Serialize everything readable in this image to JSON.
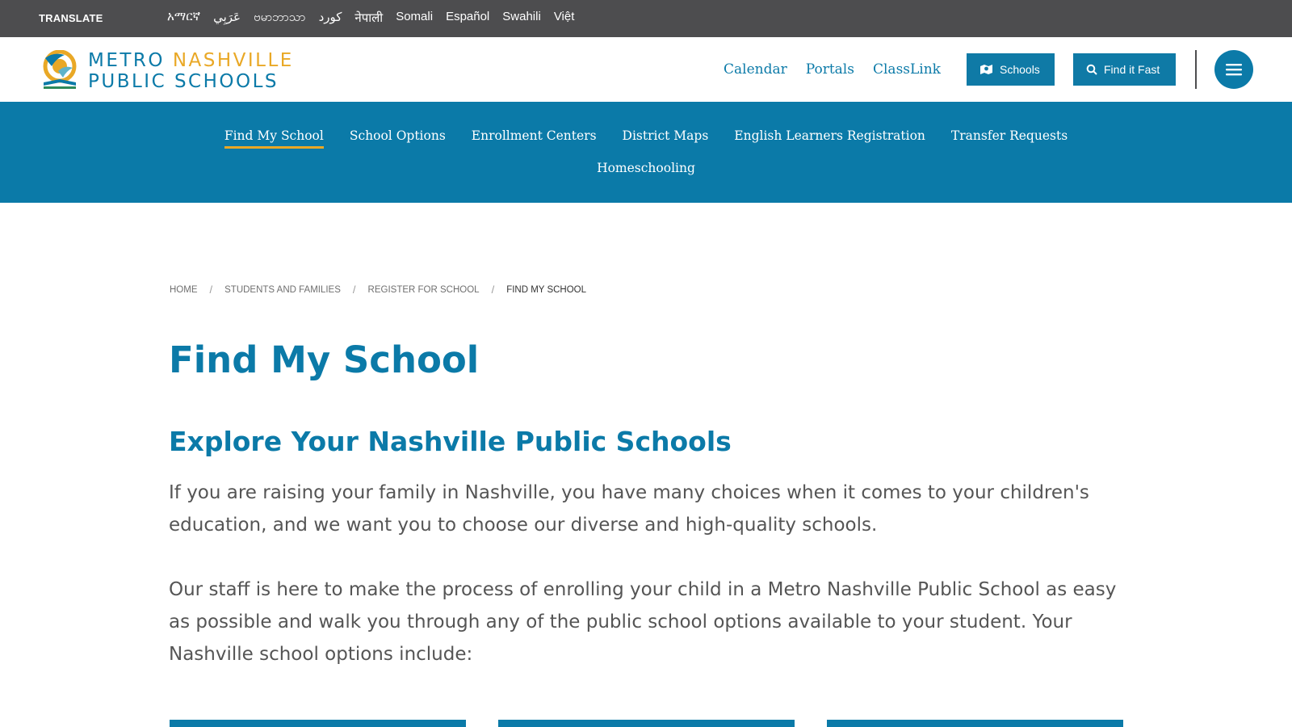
{
  "translate": {
    "label": "TRANSLATE",
    "languages": [
      "አማርኛ",
      "عَرَبِي",
      "ဗမာဘာသာ",
      "كورد",
      "नेपाली",
      "Somali",
      "Español",
      "Swahili",
      "Việt"
    ]
  },
  "header": {
    "logo": {
      "line1_a": "METRO",
      "line1_b": "NASHVILLE",
      "line2": "PUBLIC SCHOOLS"
    },
    "links": [
      "Calendar",
      "Portals",
      "ClassLink"
    ],
    "schools_button": "Schools",
    "find_button": "Find it Fast"
  },
  "nav": {
    "row1": [
      "Find My School",
      "School Options",
      "Enrollment Centers",
      "District Maps",
      "English Learners Registration",
      "Transfer Requests"
    ],
    "row2": [
      "Homeschooling"
    ]
  },
  "breadcrumb": {
    "home": "HOME",
    "students": "STUDENTS AND FAMILIES",
    "register": "REGISTER FOR SCHOOL",
    "current": "FIND MY SCHOOL"
  },
  "main": {
    "title": "Find My School",
    "section_title": "Explore Your Nashville Public Schools",
    "paragraph1": "If you are raising your family in Nashville, you have many choices when it comes to your children's education, and we want you to choose our diverse and high-quality schools.",
    "paragraph2": "Our staff is here to make the process of enrolling your child in a Metro Nashville Public School as easy as possible and walk you through any of the public school options available to your student. Your Nashville school options include:"
  },
  "colors": {
    "brand_blue": "#0b7aa8",
    "brand_gold": "#e9a826",
    "translate_bar": "#4d4d4f"
  }
}
